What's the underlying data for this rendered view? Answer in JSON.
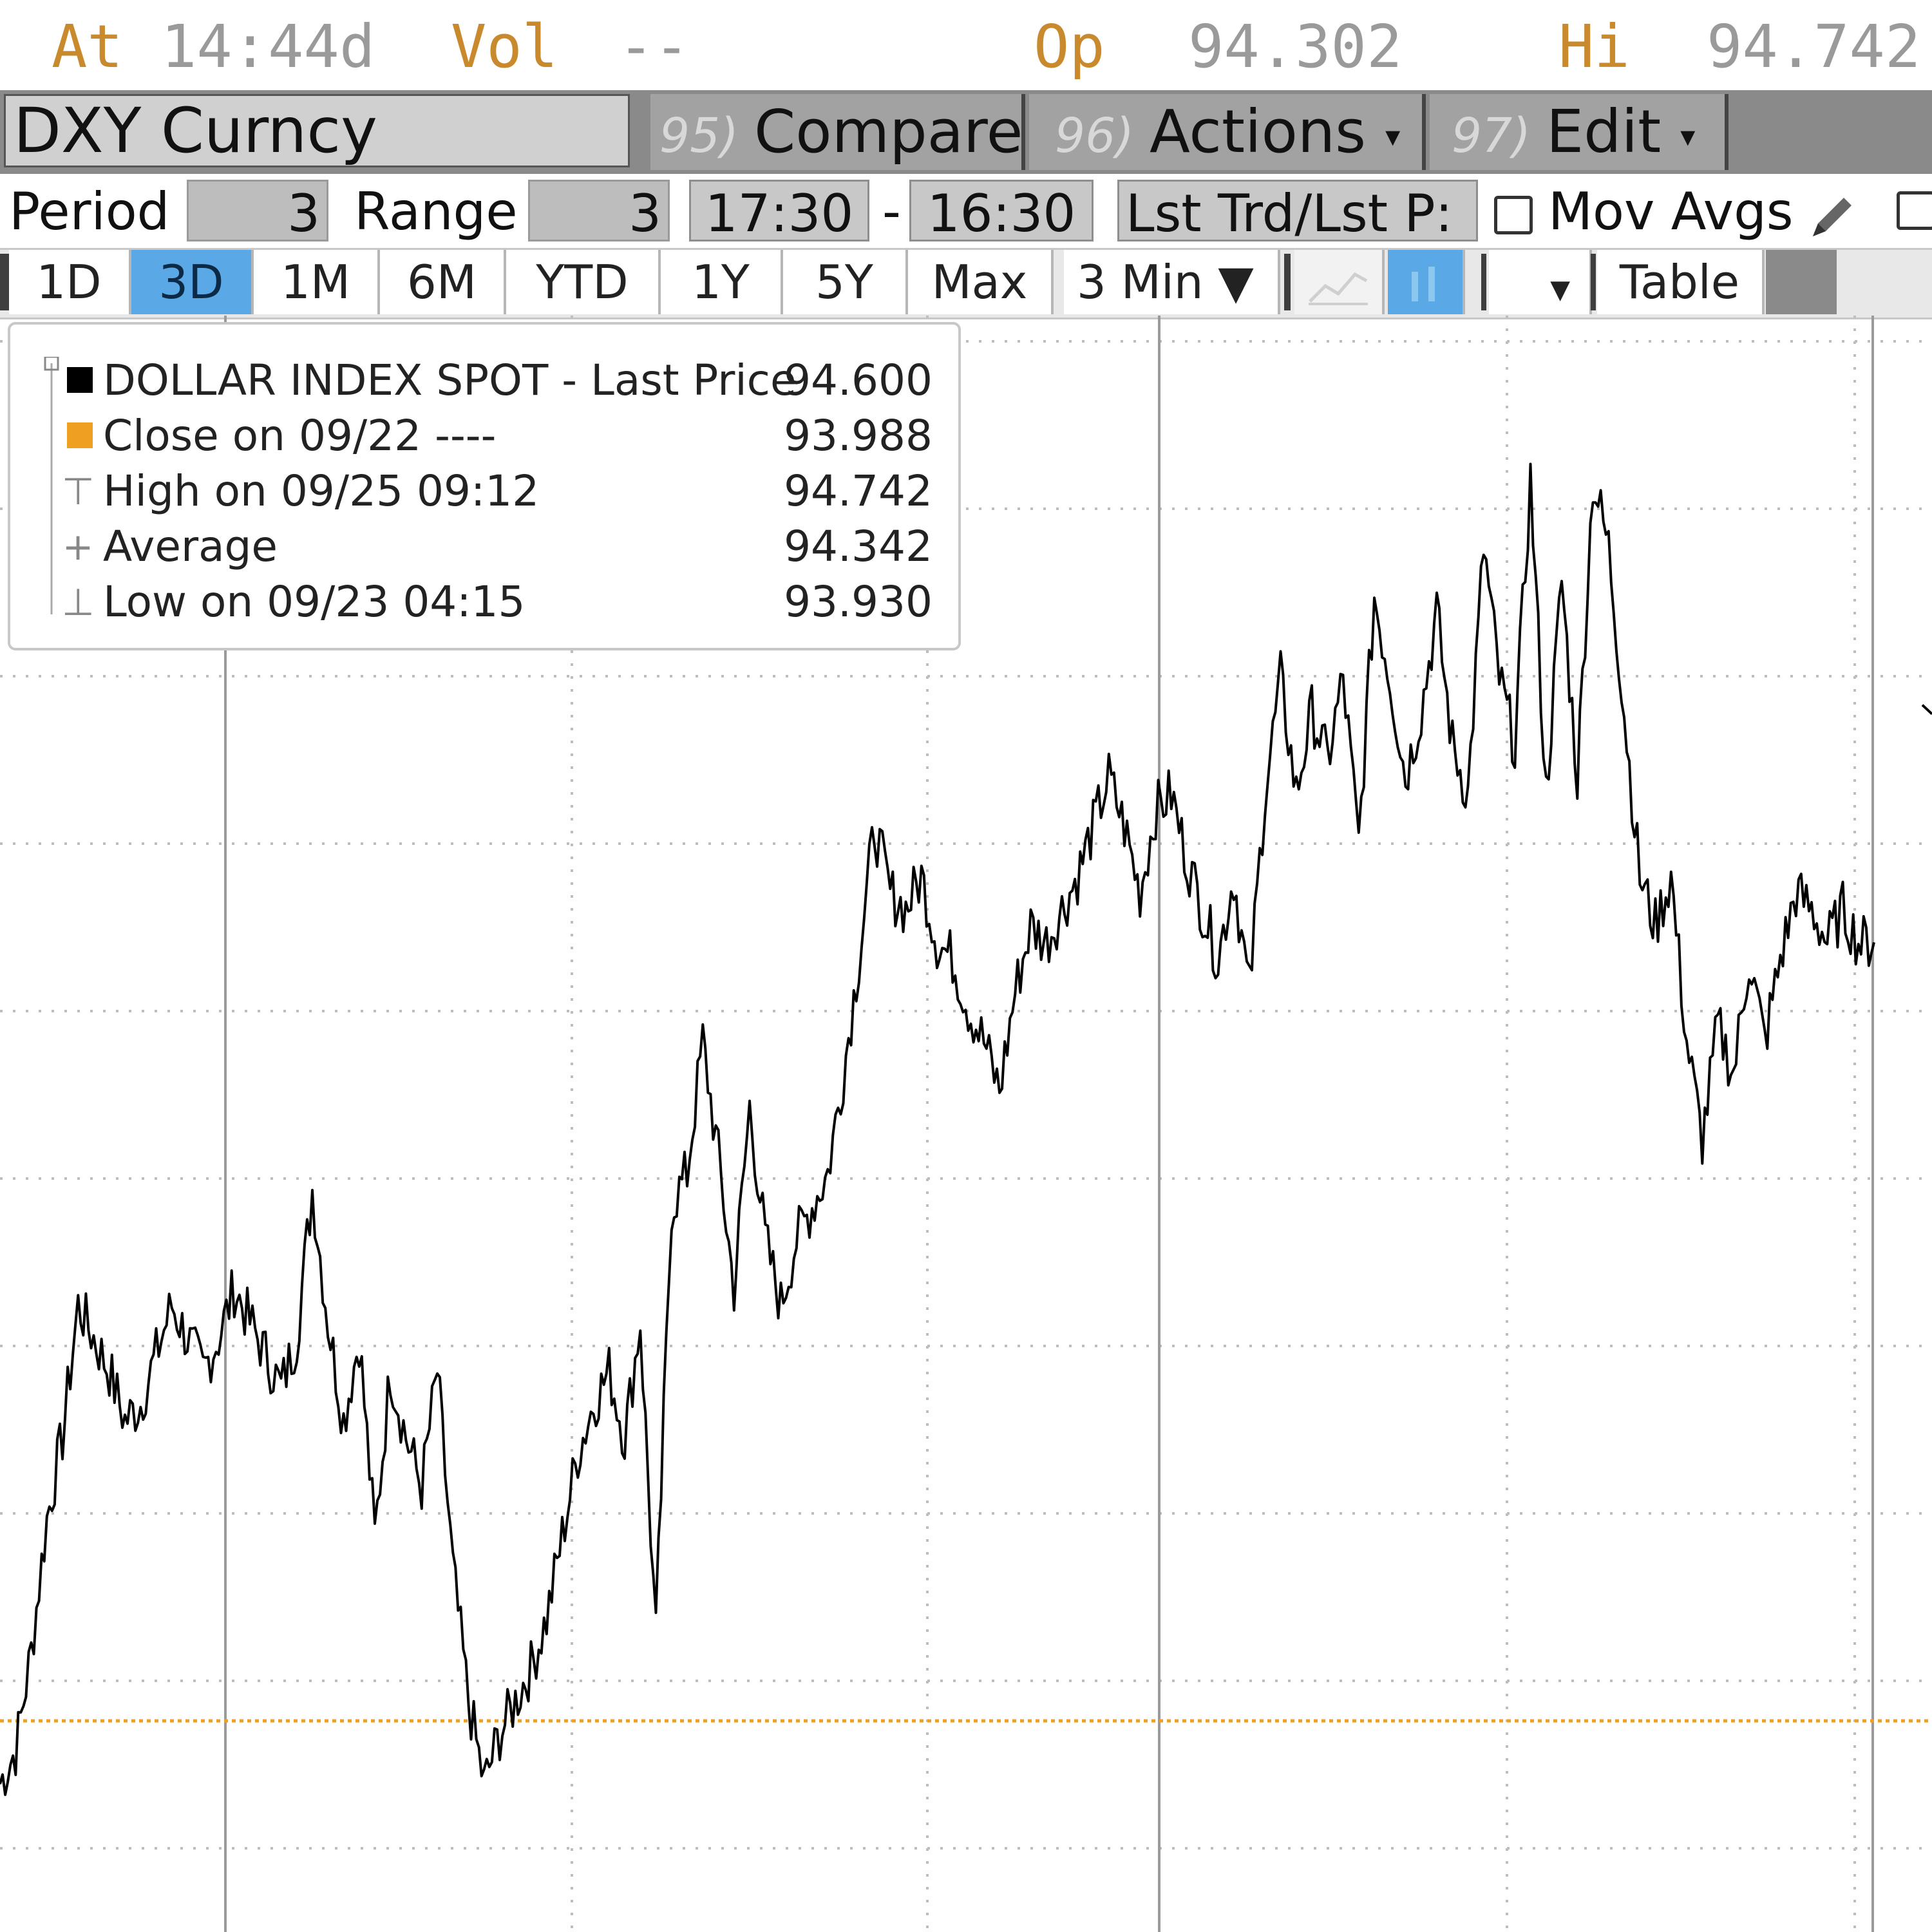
{
  "quote": {
    "at_label": "At",
    "at_time": "14:44d",
    "vol_label": "Vol",
    "vol_value": "--",
    "open_label": "Op",
    "open_value": "94.302",
    "high_label": "Hi",
    "high_value": "94.742"
  },
  "security": {
    "ticker": "DXY Curncy",
    "buttons": [
      {
        "num": "95)",
        "label": "Compare",
        "caret": ""
      },
      {
        "num": "96)",
        "label": "Actions",
        "caret": "▾"
      },
      {
        "num": "97)",
        "label": "Edit",
        "caret": "▾"
      }
    ]
  },
  "period_row": {
    "period_label": "Period",
    "period_value": "3",
    "range_label": "Range",
    "range_value": "3",
    "start_time": "17:30",
    "dash": "-",
    "end_time": "16:30",
    "price_type": "Lst Trd/Lst P:",
    "mov_avgs_label": "Mov Avgs"
  },
  "range_buttons": [
    "1D",
    "3D",
    "1M",
    "6M",
    "YTD",
    "1Y",
    "5Y",
    "Max"
  ],
  "active_range": "3D",
  "interval": "3 Min ▼",
  "table_label": "Table",
  "legend": {
    "rows": [
      {
        "label": "DOLLAR INDEX SPOT - Last Price",
        "value": "94.600",
        "swatch": "#000000"
      },
      {
        "label": "Close on 09/22 ----",
        "value": "93.988",
        "swatch": "#f0a020"
      },
      {
        "label": "High on 09/25 09:12",
        "value": "94.742",
        "glyph": "⊤"
      },
      {
        "label": "Average",
        "value": "94.342",
        "glyph": "+"
      },
      {
        "label": "Low on 09/23 04:15",
        "value": "93.930",
        "glyph": "⊥"
      }
    ]
  },
  "colors": {
    "accent_orange": "#f0a020",
    "label_orange": "#c98a2e",
    "active_blue": "#5aa9e6",
    "line": "#000000"
  },
  "chart_data": {
    "type": "line",
    "series": [
      {
        "name": "DOLLAR INDEX SPOT - Last Price",
        "values": [
          93.95,
          93.97,
          94.03,
          94.11,
          94.16,
          94.24,
          94.22,
          94.2,
          94.17,
          94.18,
          94.21,
          94.24,
          94.22,
          94.2,
          94.22,
          94.25,
          94.23,
          94.21,
          94.19,
          94.22,
          94.31,
          94.23,
          94.17,
          94.22,
          94.1,
          94.2,
          94.16,
          94.13,
          94.2,
          94.08,
          94.0,
          93.95,
          93.98,
          94.0,
          94.02,
          94.05,
          94.1,
          94.15,
          94.18,
          94.2,
          94.16,
          94.23,
          94.04,
          94.3,
          94.32,
          94.4,
          94.33,
          94.25,
          94.36,
          94.28,
          94.24,
          94.28,
          94.3,
          94.32,
          94.38,
          94.45,
          94.53,
          94.49,
          94.48,
          94.5,
          94.46,
          94.45,
          94.42,
          94.4,
          94.37,
          94.43,
          94.47,
          94.46,
          94.48,
          94.5,
          94.53,
          94.56,
          94.53,
          94.49,
          94.54,
          94.55,
          94.51,
          94.48,
          94.45,
          94.5,
          94.43,
          94.55,
          94.62,
          94.55,
          94.6,
          94.57,
          94.62,
          94.52,
          94.67,
          94.62,
          94.56,
          94.6,
          94.66,
          94.58,
          94.55,
          94.7,
          94.62,
          94.58,
          94.74,
          94.55,
          94.68,
          94.56,
          94.74,
          94.7,
          94.6,
          94.5,
          94.47,
          94.5,
          94.4,
          94.34,
          94.41,
          94.38,
          94.45,
          94.4,
          94.45,
          94.49,
          94.48,
          94.46,
          94.48,
          94.46,
          94.46
        ]
      }
    ],
    "reference_lines": [
      {
        "name": "Close on 09/22",
        "value": 93.988
      }
    ],
    "high": 94.742,
    "low": 93.93,
    "average": 94.342,
    "last": 94.6,
    "ylim": [
      93.86,
      94.84
    ]
  }
}
